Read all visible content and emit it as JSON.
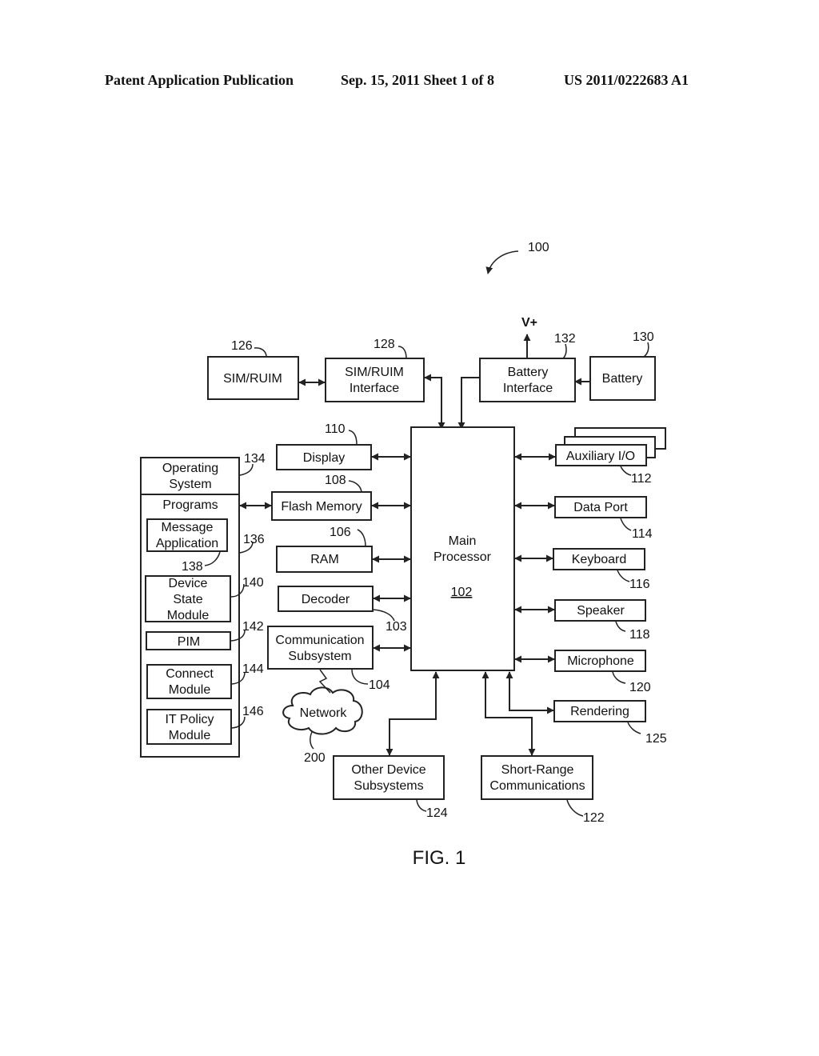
{
  "header": {
    "publication": "Patent Application Publication",
    "date_sheet": "Sep. 15, 2011   Sheet 1 of 8",
    "number": "US 2011/0222683 A1"
  },
  "figure": {
    "label": "FIG. 1",
    "system_ref": "100",
    "vplus": "V+",
    "blocks": {
      "sim_ruim": {
        "lines": [
          "SIM/RUIM"
        ],
        "ref": "126"
      },
      "sim_ruim_interface": {
        "lines": [
          "SIM/RUIM",
          "Interface"
        ],
        "ref": "128"
      },
      "battery_interface": {
        "lines": [
          "Battery",
          "Interface"
        ],
        "ref": "132"
      },
      "battery": {
        "lines": [
          "Battery"
        ],
        "ref": "130"
      },
      "display": {
        "lines": [
          "Display"
        ],
        "ref": "110"
      },
      "flash_memory": {
        "lines": [
          "Flash Memory"
        ],
        "ref": "108"
      },
      "ram": {
        "lines": [
          "RAM"
        ],
        "ref": "106"
      },
      "decoder": {
        "lines": [
          "Decoder"
        ],
        "ref": "103"
      },
      "communication_subsystem": {
        "lines": [
          "Communication",
          "Subsystem"
        ],
        "ref": "104"
      },
      "network": {
        "lines": [
          "Network"
        ],
        "ref": "200"
      },
      "main_processor": {
        "lines": [
          "Main",
          "Processor"
        ],
        "ref": "102"
      },
      "auxiliary_io": {
        "lines": [
          "Auxiliary I/O"
        ],
        "ref": "112"
      },
      "data_port": {
        "lines": [
          "Data Port"
        ],
        "ref": "114"
      },
      "keyboard": {
        "lines": [
          "Keyboard"
        ],
        "ref": "116"
      },
      "speaker": {
        "lines": [
          "Speaker"
        ],
        "ref": "118"
      },
      "microphone": {
        "lines": [
          "Microphone"
        ],
        "ref": "120"
      },
      "rendering": {
        "lines": [
          "Rendering"
        ],
        "ref": "125"
      },
      "other_device_subsystems": {
        "lines": [
          "Other Device",
          "Subsystems"
        ],
        "ref": "124"
      },
      "short_range_communications": {
        "lines": [
          "Short-Range",
          "Communications"
        ],
        "ref": "122"
      },
      "operating_system": {
        "lines": [
          "Operating",
          "System"
        ],
        "ref": "134"
      },
      "programs": {
        "lines": [
          "Programs"
        ],
        "ref": "136"
      },
      "message_application": {
        "lines": [
          "Message",
          "Application"
        ],
        "ref": "138"
      },
      "device_state_module": {
        "lines": [
          "Device",
          "State",
          "Module"
        ],
        "ref": "140"
      },
      "pim": {
        "lines": [
          "PIM"
        ],
        "ref": "142"
      },
      "connect_module": {
        "lines": [
          "Connect",
          "Module"
        ],
        "ref": "144"
      },
      "it_policy_module": {
        "lines": [
          "IT Policy",
          "Module"
        ],
        "ref": "146"
      }
    }
  }
}
